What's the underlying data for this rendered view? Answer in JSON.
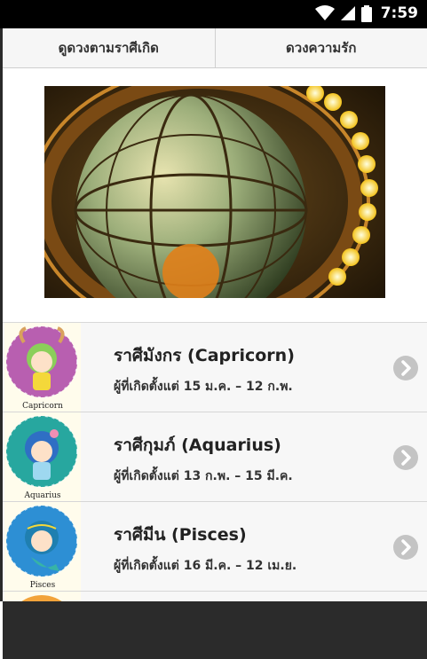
{
  "status_bar": {
    "time": "7:59",
    "icons": [
      "wifi-icon",
      "cellular-signal-icon",
      "battery-icon"
    ]
  },
  "tabs": [
    {
      "label": "ดูดวงตามราศีเกิด"
    },
    {
      "label": "ดวงความรัก"
    }
  ],
  "banner": {
    "image": "vintage-globe-with-lights"
  },
  "zodiac_list": [
    {
      "title": "ราศีมังกร (Capricorn)",
      "subtitle": "ผู้ที่เกิดตั้งแต่ 15 ม.ค. – 12 ก.พ.",
      "thumb_caption": "Capricorn",
      "thumb_color": "#b85fb0"
    },
    {
      "title": "ราศีกุมภ์ (Aquarius)",
      "subtitle": "ผู้ที่เกิดตั้งแต่ 13 ก.พ. – 15 มี.ค.",
      "thumb_caption": "Aquarius",
      "thumb_color": "#27a79f"
    },
    {
      "title": "ราศีมีน (Pisces)",
      "subtitle": "ผู้ที่เกิดตั้งแต่ 16 มี.ค. – 12 เม.ย.",
      "thumb_caption": "Pisces",
      "thumb_color": "#2d8fd4"
    }
  ],
  "colors": {
    "status_bar": "#000000",
    "tab_bg": "#f6f6f6",
    "row_bg": "#f7f7f7",
    "chevron": "#c4c4c4",
    "bottom_bar": "#2b2b2b"
  }
}
